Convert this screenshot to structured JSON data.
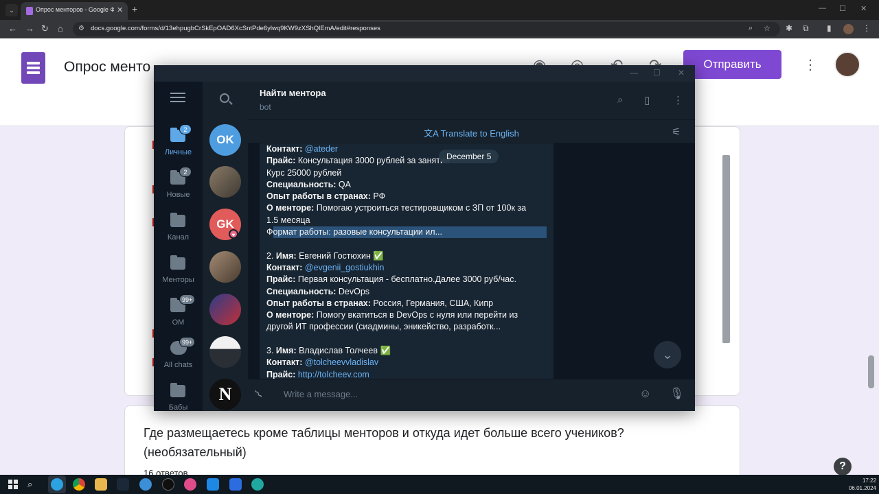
{
  "browser": {
    "tab_title": "Опрос менторов - Google Фор",
    "url": "docs.google.com/forms/d/13ehpugbCrSkEpOAD6XcSntPde6ylwq9KW9zXShQlEmA/edit#responses"
  },
  "forms": {
    "title": "Опрос менто",
    "send_label": "Отправить",
    "question_text": "Где размещаетесь кроме таблицы менторов и откуда идет больше всего учеников? (необязательный)",
    "responses_count": "16 ответов",
    "accent_color": "#7f48d3"
  },
  "telegram": {
    "chat_title": "Найти ментора",
    "chat_subtitle": "bot",
    "translate_label": "Translate to English",
    "date_label": "December 5",
    "composer_placeholder": "Write a message...",
    "folders": [
      {
        "label": "Личные",
        "badge": "2",
        "active": true
      },
      {
        "label": "Новые",
        "badge": "2",
        "active": false
      },
      {
        "label": "Канал",
        "badge": "",
        "active": false
      },
      {
        "label": "Менторы",
        "badge": "",
        "active": false
      },
      {
        "label": "ОМ",
        "badge": "99+",
        "active": false
      },
      {
        "label": "All chats",
        "badge": "99+",
        "active": false
      },
      {
        "label": "Бабы",
        "badge": "",
        "active": false
      }
    ],
    "chat_avatars": [
      {
        "initials": "OK",
        "color": "#4e9de0"
      },
      {
        "initials": "",
        "color": "#6b6458"
      },
      {
        "initials": "GK",
        "color": "#e25b5b"
      },
      {
        "initials": "",
        "color": "#7a6a5c"
      },
      {
        "initials": "",
        "color": "#3b4a8f"
      },
      {
        "initials": "",
        "color": "#3a3f48"
      },
      {
        "initials": "N",
        "color": "#111111"
      }
    ],
    "message": {
      "m1_contact_label": "Контакт:",
      "m1_contact": "@ateder",
      "m1_price_label": "Прайс:",
      "m1_price": "Консультация 3000 рублей за занятие",
      "m1_course": "Курс 25000 рублей",
      "m1_spec_label": "Специальность:",
      "m1_spec": "QA",
      "m1_exp_label": "Опыт работы в странах:",
      "m1_exp": "РФ",
      "m1_about_label": "О менторе:",
      "m1_about_1": "Помогаю устроиться тестировщиком с ЗП от 100к за",
      "m1_about_2": "1.5 месяца",
      "m1_format_1": "Ф",
      "m1_format_2": "ормат работы: разовые консультации ил...",
      "m2_num": "2.",
      "m2_name_label": "Имя:",
      "m2_name": "Евгений Гостюхин",
      "m2_contact_label": "Контакт:",
      "m2_contact": "@evgenii_gostiukhin",
      "m2_price_label": "Прайс:",
      "m2_price": "Первая консультация - бесплатно.Далее 3000 руб/час.",
      "m2_spec_label": "Специальность:",
      "m2_spec": "DevOps",
      "m2_exp_label": "Опыт работы в странах:",
      "m2_exp": "Россия, Германия, США, Кипр",
      "m2_about_label": "О менторе:",
      "m2_about_1": "Помогу вкатиться в DevOps с нуля или перейти из",
      "m2_about_2": "другой ИТ профессии (сиадмины, эникейство, разработк...",
      "m3_num": "3.",
      "m3_name_label": "Имя:",
      "m3_name": "Владислав Толчеев",
      "m3_contact_label": "Контакт:",
      "m3_contact": "@tolcheevvladislav",
      "m3_price_label": "Прайс:",
      "m3_price": "http://tolcheev.com",
      "check_emoji": "✅"
    }
  },
  "taskbar": {
    "time": "17:22",
    "date": "06.01.2024",
    "telegram_badge": "30"
  }
}
